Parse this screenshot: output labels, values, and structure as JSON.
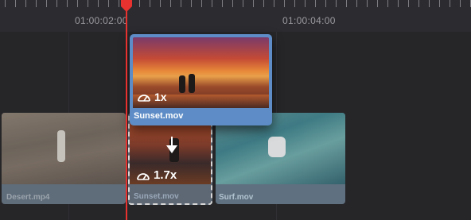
{
  "ruler": {
    "timecodes": [
      "01:00:02:00",
      "01:00:04:00"
    ]
  },
  "clips": {
    "desert": {
      "name": "Desert.mp4"
    },
    "sunset_top": {
      "name": "Sunset.mov",
      "speed": "1x"
    },
    "sunset_lower": {
      "name": "Sunset.mov",
      "speed": "1.7x"
    },
    "surf": {
      "name": "Surf.mov"
    }
  },
  "colors": {
    "playhead": "#e8322f",
    "selected_clip": "#5d8cc6",
    "clip": "#5f6c79",
    "background": "#262629"
  },
  "icons": {
    "speed": "speedometer-icon",
    "arrow": "arrow-down-icon",
    "playhead": "playhead-marker-icon"
  }
}
